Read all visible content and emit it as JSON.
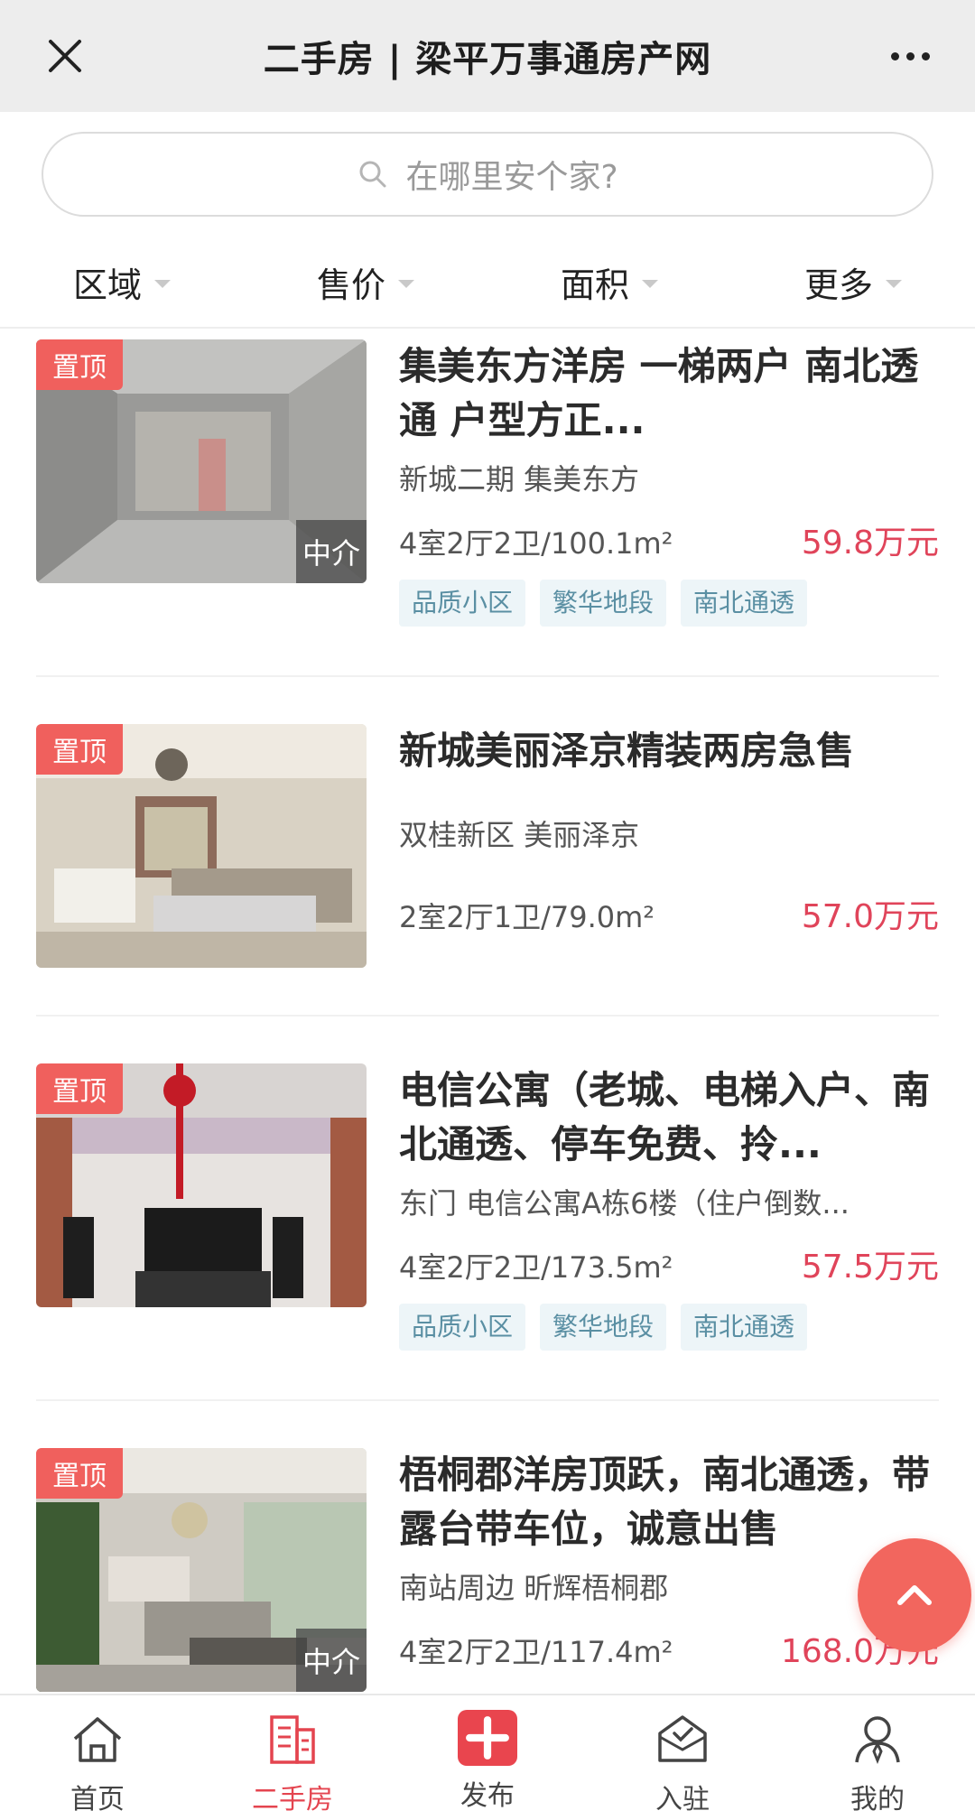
{
  "header": {
    "title": "二手房 | 梁平万事通房产网",
    "close_icon": "close-icon",
    "more_icon": "more-icon"
  },
  "search": {
    "placeholder": "在哪里安个家?",
    "icon": "search-icon"
  },
  "filters": [
    {
      "label": "区域"
    },
    {
      "label": "售价"
    },
    {
      "label": "面积"
    },
    {
      "label": "更多"
    }
  ],
  "listings": [
    {
      "badge": "置顶",
      "agent": "中介",
      "title": "集美东方洋房 一梯两户 南北透通 户型方正...",
      "location": "新城二期 集美东方",
      "specs": "4室2厅2卫/100.1m²",
      "price": "59.8万元",
      "tags": [
        "品质小区",
        "繁华地段",
        "南北通透"
      ]
    },
    {
      "badge": "置顶",
      "agent": "",
      "title": "新城美丽泽京精装两房急售",
      "location": "双桂新区 美丽泽京",
      "specs": "2室2厅1卫/79.0m²",
      "price": "57.0万元",
      "tags": []
    },
    {
      "badge": "置顶",
      "agent": "",
      "title": "电信公寓（老城、电梯入户、南北通透、停车免费、拎...",
      "location": "东门 电信公寓A栋6楼（住户倒数...",
      "specs": "4室2厅2卫/173.5m²",
      "price": "57.5万元",
      "tags": [
        "品质小区",
        "繁华地段",
        "南北通透"
      ]
    },
    {
      "badge": "置顶",
      "agent": "中介",
      "title": "梧桐郡洋房顶跃，南北通透，带露台带车位，诚意出售",
      "location": "南站周边 昕辉梧桐郡",
      "specs": "4室2厅2卫/117.4m²",
      "price": "168.0万元",
      "tags": []
    }
  ],
  "bottom_nav": [
    {
      "label": "首页",
      "icon": "home-icon",
      "active": false
    },
    {
      "label": "二手房",
      "icon": "building-icon",
      "active": true
    },
    {
      "label": "发布",
      "icon": "plus-icon",
      "active": false
    },
    {
      "label": "入驻",
      "icon": "checkin-icon",
      "active": false
    },
    {
      "label": "我的",
      "icon": "user-icon",
      "active": false
    }
  ],
  "fab": {
    "icon": "chevron-up-icon"
  },
  "colors": {
    "accent": "#e4444f",
    "price": "#e0445a",
    "badge": "#f0605d",
    "tag_text": "#5a8fa3",
    "tag_bg": "#edf5f8"
  }
}
